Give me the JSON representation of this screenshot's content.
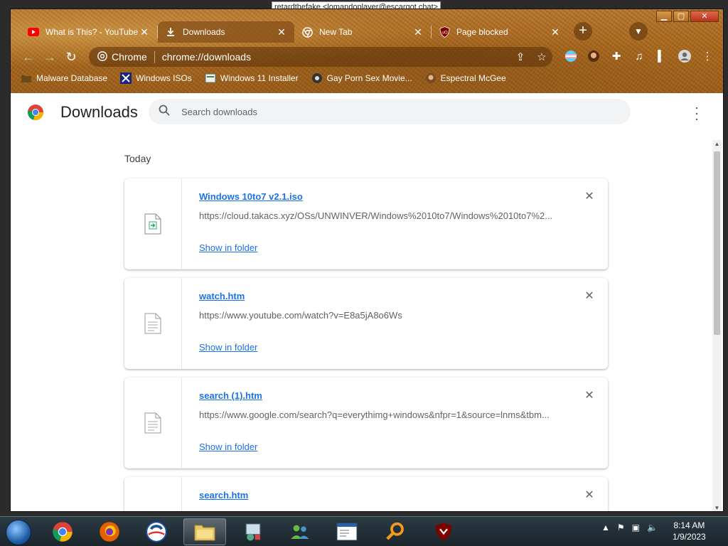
{
  "top_notice": "retardthefake <lomandoplayer@escargot.chat>",
  "window_controls": {
    "minimize": "▁",
    "maximize": "▢",
    "close": "✕"
  },
  "tabs": [
    {
      "title": "What is This? - YouTube",
      "icon": "youtube-icon",
      "active": false
    },
    {
      "title": "Downloads",
      "icon": "download-icon",
      "active": true
    },
    {
      "title": "New Tab",
      "icon": "chrome-icon",
      "active": false
    },
    {
      "title": "Page blocked",
      "icon": "ublock-icon",
      "active": false
    }
  ],
  "toolbar": {
    "chip_label": "Chrome",
    "url": "chrome://downloads"
  },
  "bookmarks": [
    {
      "label": "Malware Database",
      "icon": "folder-bookmark-icon"
    },
    {
      "label": "Windows ISOs",
      "icon": "x-logo-icon"
    },
    {
      "label": "Windows 11 Installer",
      "icon": "installer-icon"
    },
    {
      "label": "Gay Porn Sex Movie...",
      "icon": "site-favicon-icon"
    },
    {
      "label": "Espectral McGee",
      "icon": "avatar-favicon-icon"
    }
  ],
  "page": {
    "title": "Downloads",
    "search_placeholder": "Search downloads",
    "section_label": "Today"
  },
  "downloads": [
    {
      "name": "Windows 10to7 v2.1.iso",
      "url": "https://cloud.takacs.xyz/OSs/UNWINVER/Windows%2010to7/Windows%2010to7%2...",
      "action": "Show in folder",
      "icon": "iso-file-icon"
    },
    {
      "name": "watch.htm",
      "url": "https://www.youtube.com/watch?v=E8a5jA8o6Ws",
      "action": "Show in folder",
      "icon": "document-file-icon"
    },
    {
      "name": "search (1).htm",
      "url": "https://www.google.com/search?q=everythimg+windows&nfpr=1&source=lnms&tbm...",
      "action": "Show in folder",
      "icon": "document-file-icon"
    },
    {
      "name": "search.htm",
      "url": "",
      "action": "",
      "icon": "document-file-icon"
    }
  ],
  "taskbar": {
    "apps": [
      "chrome",
      "firefox",
      "obama",
      "explorer",
      "control-panel",
      "network",
      "document",
      "search",
      "ublock"
    ],
    "time": "8:14 AM",
    "date": "1/9/2023"
  }
}
